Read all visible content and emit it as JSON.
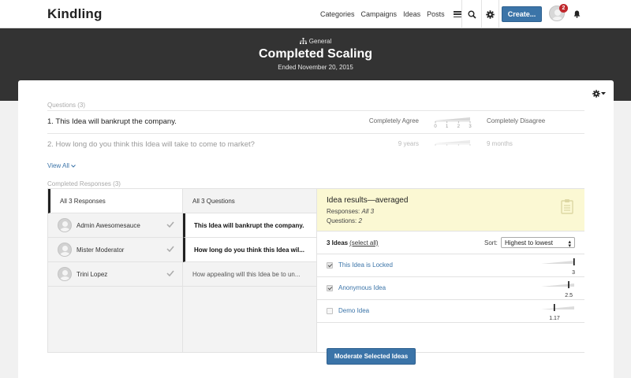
{
  "app": {
    "name": "Kindling"
  },
  "nav": {
    "links": [
      "Categories",
      "Campaigns",
      "Ideas",
      "Posts"
    ],
    "create_label": "Create...",
    "notification_count": "2",
    "icons": [
      "menu-icon",
      "search-icon",
      "gear-icon",
      "avatar",
      "bell-icon"
    ]
  },
  "banner": {
    "category": "General",
    "title": "Completed Scaling",
    "subtitle": "Ended November 20, 2015"
  },
  "questions": {
    "label": "Questions (3)",
    "items": [
      {
        "text": "1. This Idea will bankrupt the company.",
        "low": "Completely Agree",
        "high": "Completely Disagree",
        "scale": [
          "0",
          "1",
          "2",
          "3"
        ]
      },
      {
        "text": "2. How long do you think this Idea will take to come to market?",
        "low": "9 years",
        "high": "9 months"
      }
    ],
    "view_all": "View All"
  },
  "responses": {
    "label": "Completed Responses (3)",
    "all_label": "All 3 Responses",
    "people": [
      "Admin Awesomesauce",
      "Mister Moderator",
      "Trini Lopez"
    ]
  },
  "questions_col": {
    "all_label": "All 3 Questions",
    "items": [
      "This Idea will bankrupt the company.",
      "How long do you think this Idea wil...",
      "How appealing will this Idea be to un..."
    ]
  },
  "results": {
    "title": "Idea results—averaged",
    "responses_label": "Responses:",
    "responses_value": "All 3",
    "questions_label": "Questions:",
    "questions_value": "2",
    "ideas_count": "3 Ideas",
    "select_all": "(select all)",
    "sort_label": "Sort:",
    "sort_value": "Highest to lowest",
    "ideas": [
      {
        "name": "This Idea is Locked",
        "value": "3",
        "checked": true,
        "fraction": 1.0
      },
      {
        "name": "Anonymous Idea",
        "value": "2.5",
        "checked": true,
        "fraction": 0.833
      },
      {
        "name": "Demo Idea",
        "value": "1.17",
        "checked": false,
        "fraction": 0.39
      }
    ],
    "moderate_label": "Moderate Selected Ideas"
  },
  "colors": {
    "accent": "#3b74a8",
    "banner": "#333333",
    "highlight": "#fbf8d3",
    "badge": "#c0282d"
  }
}
